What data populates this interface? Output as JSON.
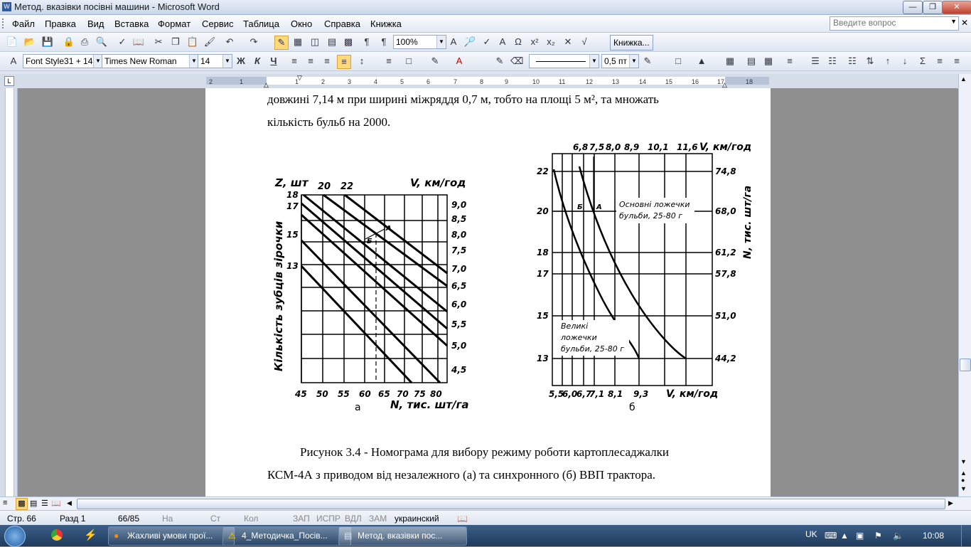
{
  "window": {
    "title": "Метод. вказівки посівні машини - Microsoft Word"
  },
  "menubar": {
    "items": [
      "Файл",
      "Правка",
      "Вид",
      "Вставка",
      "Формат",
      "Сервис",
      "Таблица",
      "Окно",
      "Справка",
      "Книжка"
    ],
    "help_placeholder": "Введите вопрос"
  },
  "toolbar1": {
    "zoom": "100%",
    "book_button": "Книжка..."
  },
  "toolbar2": {
    "style": "Font Style31 + 14",
    "font": "Times New Roman",
    "size": "14",
    "bold": "Ж",
    "italic": "К",
    "underline": "Ч",
    "line_width": "0,5 пт"
  },
  "ruler": {
    "labels": [
      "2",
      "1",
      "1",
      "2",
      "3",
      "4",
      "5",
      "6",
      "7",
      "8",
      "9",
      "10",
      "11",
      "12",
      "13",
      "14",
      "15",
      "16",
      "17",
      "18"
    ]
  },
  "document": {
    "line1": "довжині 7,14 м при ширині міжряддя 0,7 м, тобто на площі 5 м², та множать",
    "line2": "кількість бульб на 2000.",
    "caption1": "Рисунок 3.4 - Номограма для вибору режиму роботи картоплесаджалки",
    "caption2": "КСМ-4А з приводом від незалежного (а) та синхронного (б) ВВП трактора."
  },
  "figure_a": {
    "z_label": "Z, шт",
    "z_top": [
      "20",
      "22"
    ],
    "z_left": [
      "18",
      "17",
      "15",
      "13"
    ],
    "v_label": "V, км/год",
    "v_ticks": [
      "9,0",
      "8,5",
      "8,0",
      "7,5",
      "7,0",
      "6,5",
      "6,0",
      "5,5",
      "5,0",
      "4,5"
    ],
    "n_ticks": [
      "45",
      "50",
      "55",
      "60",
      "65",
      "70",
      "75",
      "80"
    ],
    "n_label": "N, тис. шт/га",
    "y_title": "Кількість зубців зірочки",
    "mark_a": "А",
    "mark_b": "Б",
    "sub": "а"
  },
  "figure_b": {
    "v_top": [
      "6,8",
      "7,5",
      "8,0",
      "8,9",
      "10,1",
      "11,6"
    ],
    "v_label": "V, км/год",
    "left_ticks": [
      "22",
      "20",
      "18",
      "17",
      "15",
      "13"
    ],
    "right_ticks": [
      "74,8",
      "68,0",
      "61,2",
      "57,8",
      "51,0",
      "44,2"
    ],
    "right_title": "N, тис. шт/га",
    "v_bottom": [
      "5,5",
      "6,0",
      "6,7",
      "7,1",
      "8,1",
      "9,3"
    ],
    "v_bottom_label": "V, км/год",
    "curve1_l1": "Основні ложечки",
    "curve1_l2": "бульби, 25-80 г",
    "curve2_l1": "Великі",
    "curve2_l2": "ложечки",
    "curve2_l3": "бульби, 25-80 г",
    "mark_a": "А",
    "mark_b": "Б",
    "sub": "б"
  },
  "status": {
    "page": "Стр. 66",
    "section": "Разд 1",
    "pages": "66/85",
    "at": "На",
    "line": "Ст",
    "col": "Кол",
    "rec": "ЗАП",
    "trk": "ИСПР",
    "ext": "ВДЛ",
    "ovr": "ЗАМ",
    "lang": "украинский"
  },
  "taskbar": {
    "tasks": [
      "Жахливі умови прої...",
      "4_Методичка_Посів...",
      "Метод. вказівки пос..."
    ],
    "lang": "UK",
    "time": "10:08"
  }
}
